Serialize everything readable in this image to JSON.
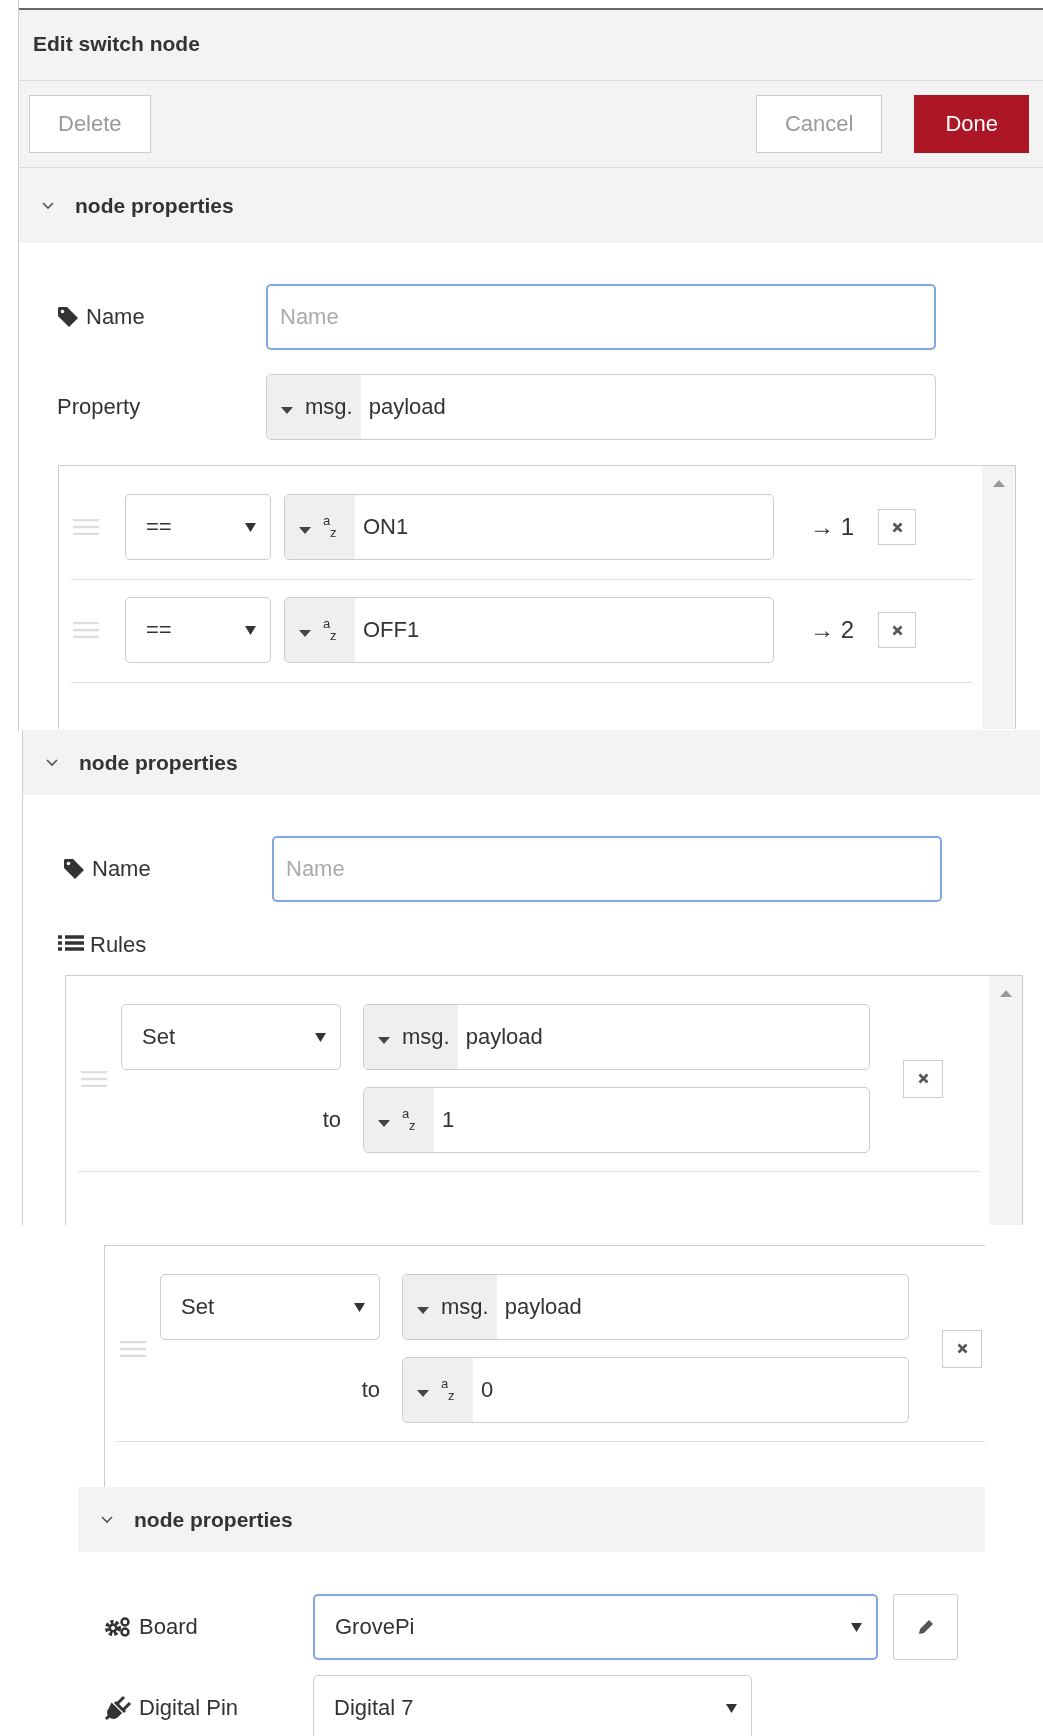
{
  "panels": [
    {
      "parts": [
        {
          "kind": "title",
          "text": "Edit switch node"
        },
        {
          "kind": "toolbar",
          "buttons": [
            {
              "label": "Delete",
              "kind": "plain"
            },
            {
              "label": "Cancel",
              "kind": "plain"
            },
            {
              "label": "Done",
              "kind": "primary"
            }
          ]
        },
        {
          "kind": "section",
          "text": "node properties",
          "expanded": true
        },
        {
          "kind": "name",
          "label": "Name",
          "control": {
            "kind": "text",
            "placeholder": "Name",
            "focused": true
          }
        },
        {
          "kind": "property",
          "label": "Property",
          "control": {
            "kind": "typed",
            "typed": {
              "kind": "msg",
              "prefix": "msg.",
              "value": "payload"
            }
          }
        },
        {
          "kind": "rules",
          "scrollbar": true,
          "rows": [
            {
              "kind": "switch",
              "operator": "==",
              "operand": {
                "kind": "str",
                "type_mark": [
                  "a",
                  "z"
                ],
                "value": "ON1"
              },
              "output": "→ 1"
            },
            {
              "kind": "switch",
              "operator": "==",
              "operand": {
                "kind": "str",
                "type_mark": [
                  "a",
                  "z"
                ],
                "value": "OFF1"
              },
              "output": "→ 2"
            }
          ]
        }
      ]
    },
    {
      "parts": [
        {
          "kind": "section",
          "text": "node properties",
          "expanded": true
        },
        {
          "kind": "name",
          "label": "Name",
          "control": {
            "kind": "text",
            "placeholder": "Name",
            "focused": true
          }
        },
        {
          "kind": "rules-label",
          "text": "Rules"
        },
        {
          "kind": "rules",
          "scrollbar": true,
          "rows": [
            {
              "kind": "change",
              "action": "Set",
              "target": {
                "kind": "msg",
                "prefix": "msg.",
                "value": "payload"
              },
              "to_label": "to",
              "value": {
                "kind": "str",
                "type_mark": [
                  "a",
                  "z"
                ],
                "value": "1"
              }
            }
          ]
        }
      ]
    },
    {
      "parts": [
        {
          "kind": "rules",
          "rows": [
            {
              "kind": "change",
              "action": "Set",
              "target": {
                "kind": "msg",
                "prefix": "msg.",
                "value": "payload"
              },
              "to_label": "to",
              "value": {
                "kind": "str",
                "type_mark": [
                  "a",
                  "z"
                ],
                "value": "0"
              }
            }
          ]
        },
        {
          "kind": "section",
          "text": "node properties",
          "expanded": true
        },
        {
          "kind": "board",
          "label": "Board",
          "control": {
            "kind": "select",
            "value": "GrovePi",
            "focused": true,
            "edit_button": true
          }
        },
        {
          "kind": "pin",
          "label": "Digital Pin",
          "control": {
            "kind": "select",
            "value": "Digital 7",
            "focused": false
          }
        }
      ]
    }
  ]
}
